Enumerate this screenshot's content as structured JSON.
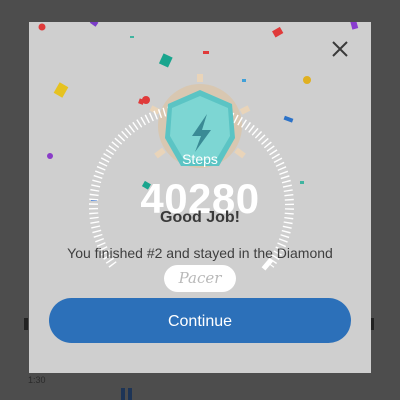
{
  "modal": {
    "steps_label": "Steps",
    "steps_value": "40280",
    "title": "Good Job!",
    "message": "You finished #2 and stayed in the Diamond",
    "brand": "Pacer",
    "continue_label": "Continue",
    "close_icon": "close-icon",
    "badge_icon": "lightning-badge-icon"
  },
  "background": {
    "time_text": "1:30"
  },
  "colors": {
    "modal_bg": "#cfcfcf",
    "continue_button": "#2c70b9",
    "badge": "#5bc4c4",
    "overlay": "#4d4d4d"
  }
}
